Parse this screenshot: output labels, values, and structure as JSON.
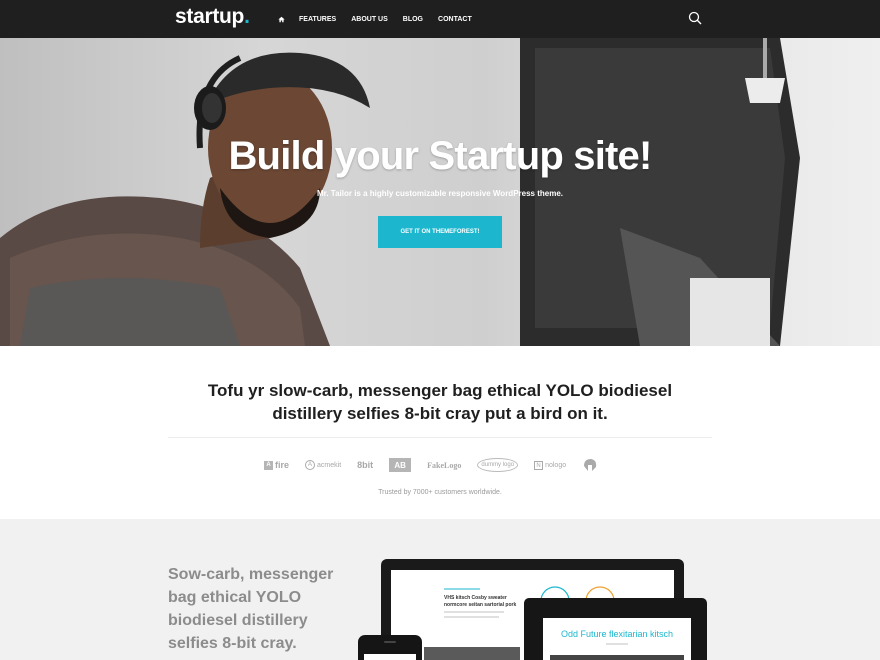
{
  "colors": {
    "accent": "#1cb7cf",
    "nav_bg": "#1f1f1f",
    "feature_bg": "#f1f1f1"
  },
  "nav": {
    "logo": "startup",
    "logo_dot": ".",
    "home_icon": "home-icon",
    "items": [
      "FEATURES",
      "ABOUT US",
      "BLOG",
      "CONTACT"
    ],
    "search_icon": "search-icon"
  },
  "hero": {
    "title": "Build your Startup site!",
    "subtitle": "Mr. Tailor is a highly customizable responsive WordPress theme.",
    "button": "GET IT ON THEMEFOREST!"
  },
  "clients": {
    "intro_line1": "Tofu yr slow-carb, messenger bag ethical YOLO biodiesel",
    "intro_line2": "distillery selfies 8-bit cray put a bird on it.",
    "logos": [
      "fire",
      "acmekit",
      "8bit",
      "AB",
      "FakeLogo",
      "dummy logo",
      "nologo"
    ],
    "trusted": "Trusted by 7000+ customers worldwide."
  },
  "feature": {
    "text_lines": [
      "Sow-carb, messenger",
      "bag ethical YOLO",
      "biodiesel distillery",
      "selfies 8-bit cray."
    ],
    "laptop_heading_1": "VHS kitsch Cosby sweater",
    "laptop_heading_2": "normcore seitan sartorial pork",
    "tablet_heading": "Odd Future flexitarian kitsch"
  }
}
